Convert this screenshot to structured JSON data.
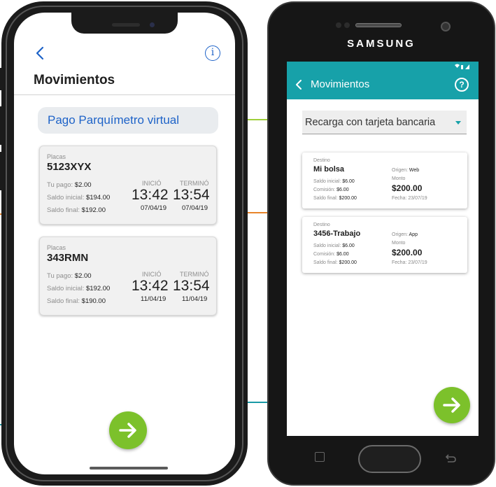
{
  "colors": {
    "ios_accent": "#1e63c8",
    "android_teal": "#17a1a9",
    "fab_green": "#7cc12b",
    "connector_green": "#9fcf3b",
    "connector_orange": "#e8842a",
    "connector_teal": "#1a9aa6"
  },
  "iphone": {
    "back_icon": "chevron-left-icon",
    "info_icon": "info-icon",
    "info_glyph": "i",
    "title": "Movimientos",
    "filter_chip": "Pago Parquímetro virtual",
    "cards": [
      {
        "placas_label": "Placas",
        "plate": "5123XYX",
        "pago_label": "Tu pago: ",
        "pago": "$2.00",
        "saldo_ini_label": "Saldo inicial: ",
        "saldo_ini": "$194.00",
        "saldo_fin_label": "Saldo final: ",
        "saldo_fin": "$192.00",
        "inicio_label": "INICIÓ",
        "termino_label": "TERMINÓ",
        "inicio_time": "13:42",
        "termino_time": "13:54",
        "inicio_date": "07/04/19",
        "termino_date": "07/04/19"
      },
      {
        "placas_label": "Placas",
        "plate": "343RMN",
        "pago_label": "Tu pago: ",
        "pago": "$2.00",
        "saldo_ini_label": "Saldo inicial: ",
        "saldo_ini": "$192.00",
        "saldo_fin_label": "Saldo final: ",
        "saldo_fin": "$190.00",
        "inicio_label": "INICIÓ",
        "termino_label": "TERMINÓ",
        "inicio_time": "13:42",
        "termino_time": "13:54",
        "inicio_date": "11/04/19",
        "termino_date": "11/04/19"
      }
    ],
    "fab_icon": "arrow-right-icon"
  },
  "samsung": {
    "brand": "SAMSUNG",
    "appbar_title": "Movimientos",
    "help_glyph": "?",
    "dropdown_value": "Recarga con tarjeta bancaria",
    "cards": [
      {
        "destino_label": "Destino",
        "destino": "Mi bolsa",
        "saldo_ini_label": "Saldo inicial: ",
        "saldo_ini": "$6.00",
        "comision_label": "Comisión: ",
        "comision": "$6.00",
        "saldo_fin_label": "Saldo final: ",
        "saldo_fin": "$200.00",
        "origen_label": "Origen: ",
        "origen": "Web",
        "monto_label": "Monto",
        "monto": "$200.00",
        "fecha_label": "Fecha: ",
        "fecha": "23/07/19"
      },
      {
        "destino_label": "Destino",
        "destino": "3456-Trabajo",
        "saldo_ini_label": "Saldo inicial: ",
        "saldo_ini": "$6.00",
        "comision_label": "Comisión: ",
        "comision": "$6.00",
        "saldo_fin_label": "Saldo final: ",
        "saldo_fin": "$200.00",
        "origen_label": "Origen: ",
        "origen": "App",
        "monto_label": "Monto",
        "monto": "$200.00",
        "fecha_label": "Fecha: ",
        "fecha": "23/07/19"
      }
    ],
    "fab_icon": "arrow-right-icon"
  }
}
